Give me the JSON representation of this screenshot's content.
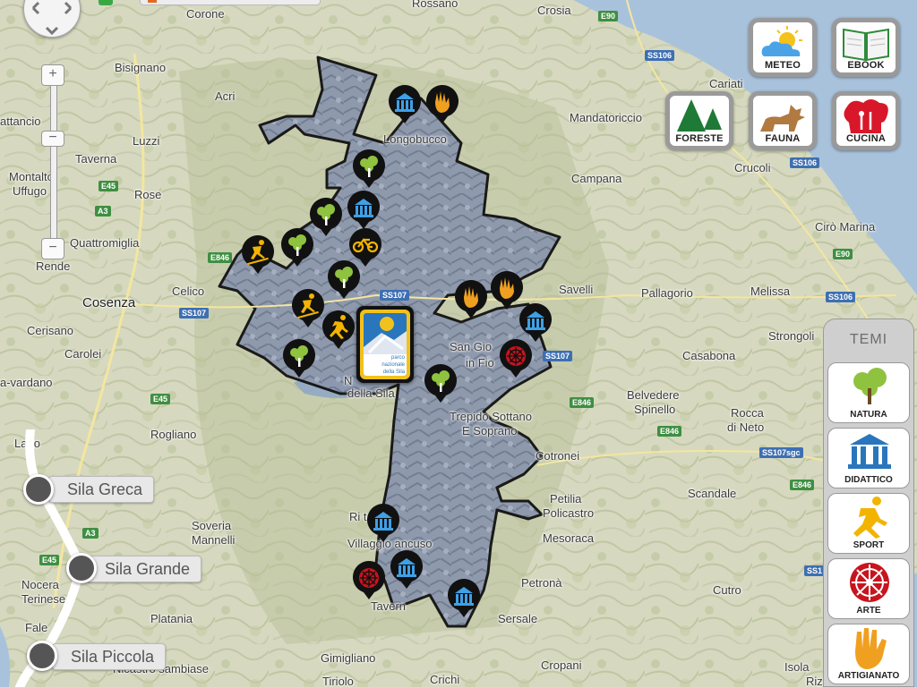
{
  "colors": {
    "land": "#d9dcc4",
    "sea": "#a9c2dc",
    "park_fill": "#8e9ab0",
    "park_border": "#111111",
    "poi_black": "#111111",
    "nature_green": "#8fc23f",
    "didactic_blue": "#2a76bc",
    "sport_yellow": "#f2b400",
    "art_red": "#c8141e",
    "craft_orange": "#f0a020"
  },
  "places": {
    "corone": "Corone",
    "rossano": "Rossano",
    "crosia": "Crosia",
    "bisignano": "Bisignano",
    "acri": "Acri",
    "mandatoriccio": "Mandatoriccio",
    "cariati": "Cariati",
    "longobucco": "Longobucco",
    "luzzi": "Luzzi",
    "campana": "Campana",
    "crucoli": "Crucoli",
    "attancio": "attancio",
    "taverna_n": "Taverna",
    "montalto": "Montalto",
    "uffugo": "Uffugo",
    "rose": "Rose",
    "quattromiglia": "Quattromiglia",
    "ciro_marina": "Cirò Marina",
    "rende": "Rende",
    "celico": "Celico",
    "savelli": "Savelli",
    "pallagorio": "Pallagorio",
    "melissa": "Melissa",
    "cosenza": "Cosenza",
    "cerisano": "Cerisano",
    "san_gio": "San Gio",
    "in_fio": "in Fio",
    "strongoli": "Strongoli",
    "carolei": "Carolei",
    "casabona": "Casabona",
    "a_vardano": "a-vardano",
    "della_sila": "della Sila",
    "n_letter": "N",
    "belvedere": "Belvedere",
    "spinello": "Spinello",
    "rocca": "Rocca",
    "di_neto": "di Neto",
    "lago": "Lago",
    "rogliano": "Rogliano",
    "trepido": "Trepido Sottano",
    "e_soprano": "E Soprano",
    "cotronei": "Cotronei",
    "scandale": "Scandale",
    "petilia": "Petilia",
    "policastro": "Policastro",
    "soveria": "Soveria",
    "mannelli": "Mannelli",
    "ristale": "Ri    tale",
    "villaggio": "Villaggio  ancuso",
    "mesoraca": "Mesoraca",
    "nocera": "Nocera",
    "terinese": "Terinese",
    "petrona": "Petronà",
    "platania": "Platania",
    "taverna_s": "Tavern",
    "cutro": "Cutro",
    "sersale": "Sersale",
    "falerna": "Fale",
    "gimigliano": "Gimigliano",
    "sambiase": "Nicastro sambiase",
    "cropani": "Cropani",
    "isola": "Isola",
    "crichi": "Crichi",
    "tiriolo": "Tiriolo",
    "riz": "Rizz"
  },
  "roads": {
    "e90_top": "E90",
    "ss106_a": "SS106",
    "ss106_b": "SS106",
    "e45_a": "E45",
    "a3_a": "A3",
    "e846_a": "E846",
    "ss107_a": "SS107",
    "ss107_b": "SS107",
    "e90_b": "E90",
    "ss106_c": "SS106",
    "ss107_c": "SS107",
    "e45_b": "E45",
    "e846_b": "E846",
    "e846_c": "E846",
    "ss107sgc": "SS107sgc",
    "e846_d": "E846",
    "a3_b": "A3",
    "e45_c": "E45",
    "ss1": "SS1"
  },
  "top_buttons": {
    "meteo": {
      "label": "METEO",
      "icon": "sun-cloud-icon"
    },
    "ebook": {
      "label": "EBOOK",
      "icon": "book-icon"
    },
    "foreste": {
      "label": "FORESTE",
      "icon": "pine-trees-icon"
    },
    "fauna": {
      "label": "FAUNA",
      "icon": "wolf-icon"
    },
    "cucina": {
      "label": "CUCINA",
      "icon": "chef-hat-icon"
    }
  },
  "temi": {
    "title": "TEMI",
    "items": [
      {
        "label": "NATURA",
        "icon": "tree-icon"
      },
      {
        "label": "DIDATTICO",
        "icon": "temple-icon"
      },
      {
        "label": "SPORT",
        "icon": "runner-icon"
      },
      {
        "label": "ARTE",
        "icon": "wheel-icon"
      },
      {
        "label": "ARTIGIANATO",
        "icon": "hand-icon"
      }
    ]
  },
  "zone_slider": {
    "items": [
      "Sila Greca",
      "Sila Grande",
      "Sila Piccola"
    ]
  },
  "park_logo": {
    "lines": [
      "parco",
      "nazionale",
      "della Sila"
    ],
    "icon": "park-logo-icon"
  },
  "zoom": {
    "plus_icon": "plus-icon",
    "minus_icon": "minus-icon"
  }
}
